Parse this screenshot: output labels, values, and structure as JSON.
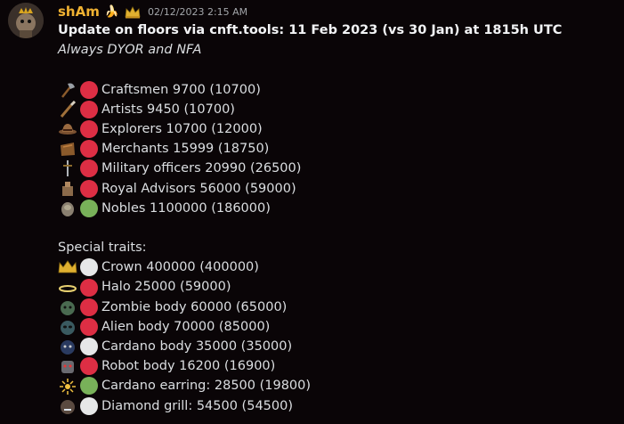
{
  "header": {
    "username": "shAm",
    "name_emoji": "🍌",
    "timestamp": "02/12/2023 2:15 AM"
  },
  "message": {
    "title": "Update on  floors via cnft.tools: 11 Feb 2023 (vs 30 Jan) at 1815h UTC",
    "subtitle": "Always DYOR and NFA",
    "classes": [
      {
        "icon": "axe-icon",
        "dot": "red",
        "text": "Craftsmen 9700 (10700)"
      },
      {
        "icon": "brush-icon",
        "dot": "red",
        "text": "Artists 9450 (10700)"
      },
      {
        "icon": "explorer-hat-icon",
        "dot": "red",
        "text": "Explorers 10700 (12000)"
      },
      {
        "icon": "merchant-bag-icon",
        "dot": "red",
        "text": "Merchants 15999 (18750)"
      },
      {
        "icon": "sword-icon",
        "dot": "red",
        "text": "Military officers 20990 (26500)"
      },
      {
        "icon": "advisor-icon",
        "dot": "red",
        "text": "Royal Advisors 56000 (59000)"
      },
      {
        "icon": "noble-icon",
        "dot": "green",
        "text": "Nobles 1100000 (186000)"
      }
    ],
    "special_heading": "Special traits:",
    "traits": [
      {
        "icon": "crown-icon",
        "dot": "white",
        "text": "Crown 400000 (400000)"
      },
      {
        "icon": "halo-icon",
        "dot": "red",
        "text": "Halo 25000 (59000)"
      },
      {
        "icon": "zombie-icon",
        "dot": "red",
        "text": "Zombie body 60000 (65000)"
      },
      {
        "icon": "alien-icon",
        "dot": "red",
        "text": "Alien body 70000 (85000)"
      },
      {
        "icon": "cardano-body-icon",
        "dot": "white",
        "text": "Cardano body 35000 (35000)"
      },
      {
        "icon": "robot-icon",
        "dot": "red",
        "text": "Robot body 16200 (16900)"
      },
      {
        "icon": "cardano-earring-icon",
        "dot": "green",
        "text": "Cardano earring: 28500 (19800)"
      },
      {
        "icon": "diamond-grill-icon",
        "dot": "white",
        "text": "Diamond grill: 54500 (54500)"
      }
    ]
  },
  "colors": {
    "red": "#dd2e44",
    "green": "#78b159",
    "white": "#e6e7e8",
    "username": "#f0b232"
  }
}
